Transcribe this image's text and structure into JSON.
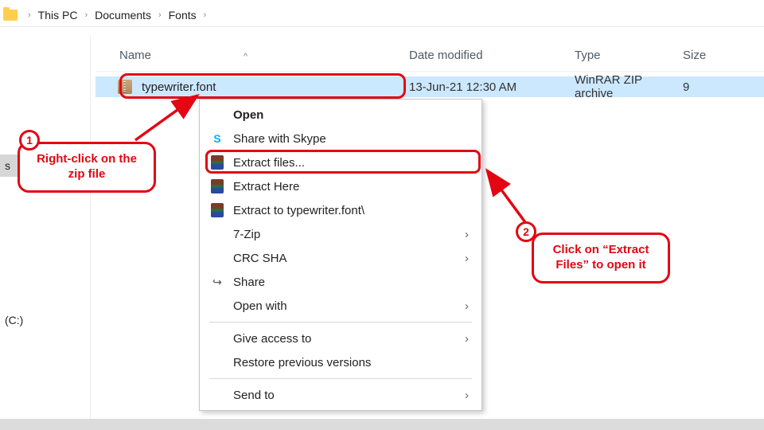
{
  "breadcrumb": {
    "items": [
      "This PC",
      "Documents",
      "Fonts"
    ]
  },
  "columns": {
    "name": "Name",
    "date": "Date modified",
    "type": "Type",
    "size": "Size",
    "sort_indicator": "^"
  },
  "file": {
    "name": "typewriter.font",
    "date": "13-Jun-21 12:30 AM",
    "type": "WinRAR ZIP archive",
    "size": "9"
  },
  "sidebar": {
    "items": [
      "s",
      "",
      "",
      "(C:)"
    ]
  },
  "context_menu": {
    "open": "Open",
    "skype": "Share with Skype",
    "extract_files": "Extract files...",
    "extract_here": "Extract Here",
    "extract_to": "Extract to typewriter.font\\",
    "seven_zip": "7-Zip",
    "crc": "CRC SHA",
    "share": "Share",
    "open_with": "Open with",
    "give_access": "Give access to",
    "restore": "Restore previous versions",
    "send_to": "Send to"
  },
  "annotations": {
    "badge1": "1",
    "text1": "Right-click on the zip file",
    "badge2": "2",
    "text2": "Click on “Extract Files” to open it"
  }
}
